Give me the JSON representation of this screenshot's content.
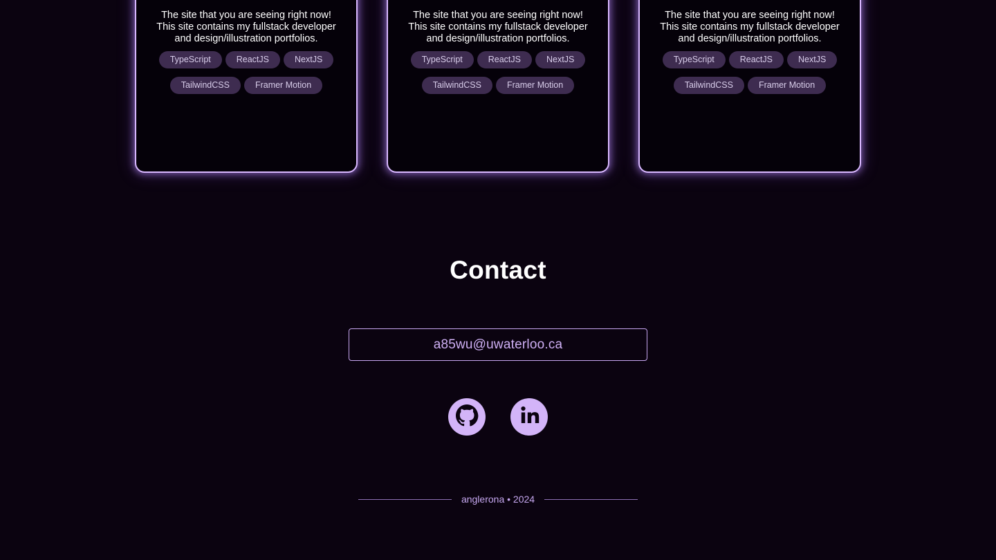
{
  "projects": [
    {
      "description": "The site that you are seeing right now! This site contains my fullstack developer and design/illustration portfolios.",
      "tags": [
        "TypeScript",
        "ReactJS",
        "NextJS",
        "TailwindCSS",
        "Framer Motion"
      ]
    },
    {
      "description": "The site that you are seeing right now! This site contains my fullstack developer and design/illustration portfolios.",
      "tags": [
        "TypeScript",
        "ReactJS",
        "NextJS",
        "TailwindCSS",
        "Framer Motion"
      ]
    },
    {
      "description": "The site that you are seeing right now! This site contains my fullstack developer and design/illustration portfolios.",
      "tags": [
        "TypeScript",
        "ReactJS",
        "NextJS",
        "TailwindCSS",
        "Framer Motion"
      ]
    }
  ],
  "contact": {
    "title": "Contact",
    "email": "a85wu@uwaterloo.ca",
    "social": [
      {
        "icon": "github-icon"
      },
      {
        "icon": "linkedin-icon"
      }
    ]
  },
  "footer": {
    "text": "anglerona • 2024"
  },
  "colors": {
    "background": "#0b0310",
    "accent": "#d3b4f8",
    "tag_bg": "#3e2c50",
    "card_border": "#d9b8ff"
  }
}
